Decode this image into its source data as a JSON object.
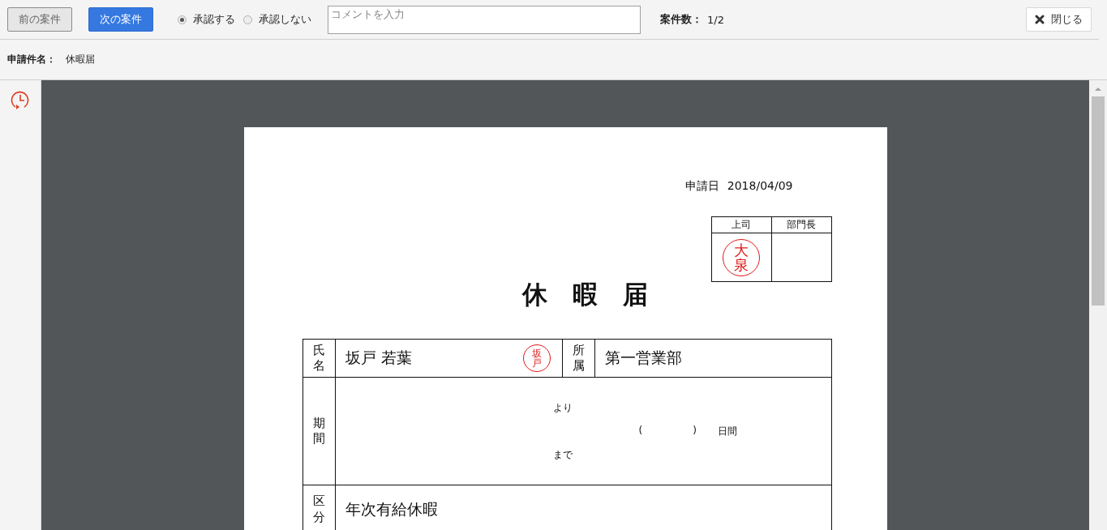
{
  "toolbar": {
    "prev_button": "前の案件",
    "next_button": "次の案件",
    "approval": [
      {
        "label": "承認する",
        "selected": true
      },
      {
        "label": "承認しない",
        "selected": false
      }
    ],
    "comment": {
      "placeholder": "コメントを入力"
    },
    "count_label": "案件数：",
    "count_value": "1/2",
    "close_button": "閉じる"
  },
  "subject": {
    "label": "申請件名：",
    "value": "休暇届"
  },
  "document": {
    "date_label": "申請日",
    "date_value": "2018/04/09",
    "approvers": [
      {
        "role": "上司",
        "stamp": [
          "大",
          "泉"
        ]
      },
      {
        "role": "部門長"
      }
    ],
    "title": "休　暇　届",
    "name_label": "氏名",
    "name_value": "坂戸  若葉",
    "name_stamp": [
      "坂",
      "戸"
    ],
    "dept_label": "所属",
    "dept_value": "第一営業部",
    "period_label": "期間",
    "period_from": "より",
    "period_open": "(",
    "period_close": ")",
    "period_days": "日間",
    "period_to": "まで",
    "type_label": "区分",
    "type_value": "年次有給休暇"
  }
}
